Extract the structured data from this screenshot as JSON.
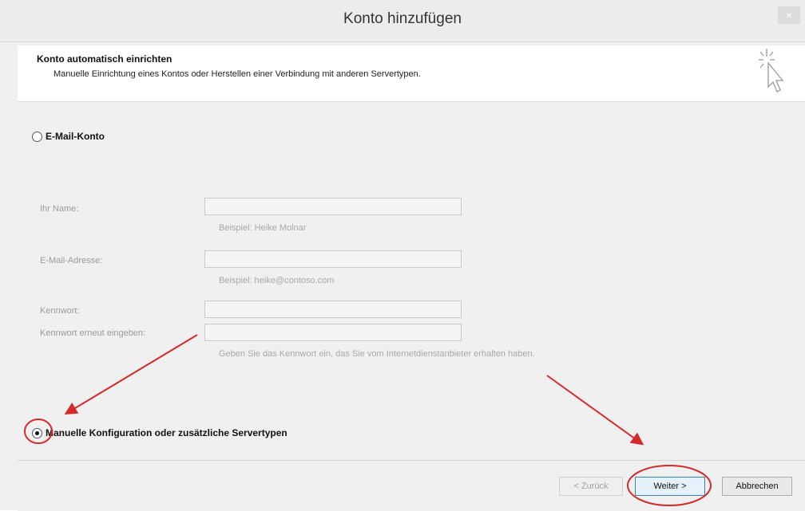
{
  "window": {
    "title": "Konto hinzufügen",
    "close_glyph": "×"
  },
  "header": {
    "title": "Konto automatisch einrichten",
    "description": "Manuelle Einrichtung eines Kontos oder Herstellen einer Verbindung mit anderen Servertypen."
  },
  "email_option": {
    "label": "E-Mail-Konto",
    "selected": false
  },
  "form": {
    "name_label": "Ihr Name:",
    "name_hint": "Beispiel: Heike Molnar",
    "email_label": "E-Mail-Adresse:",
    "email_hint": "Beispiel: heike@contoso.com",
    "password_label": "Kennwort:",
    "password_confirm_label": "Kennwort erneut eingeben:",
    "password_hint": "Geben Sie das Kennwort ein, das Sie vom Internetdienstanbieter erhalten haben."
  },
  "manual_option": {
    "label": "Manuelle Konfiguration oder zusätzliche Servertypen",
    "selected": true
  },
  "buttons": {
    "back": "< Zurück",
    "next": "Weiter >",
    "cancel": "Abbrechen"
  },
  "annotation_color": "#d42a2a"
}
